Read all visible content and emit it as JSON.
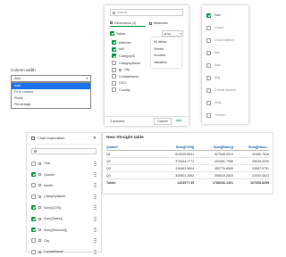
{
  "fields_panel": {
    "search_placeholder": "Search",
    "tab_dimensions": "Dimensions (4)",
    "tab_measures": "Measures",
    "tables_label": "Tables",
    "filter_value": "All tab...",
    "items": [
      {
        "label": "Address",
        "checked": true
      },
      {
        "label": "sell",
        "checked": true
      },
      {
        "label": "CategoryID",
        "checked": true
      },
      {
        "label": "CategoryName",
        "checked": false
      },
      {
        "label": "City",
        "checked": false
      },
      {
        "label": "ContactName",
        "checked": false
      },
      {
        "label": "CEO",
        "checked": false
      },
      {
        "label": "Country",
        "checked": false
      }
    ],
    "filter_menu": [
      "All tables",
      "Sheets",
      "Invoices",
      "Variables"
    ],
    "selected_count": "3 selected",
    "cancel_label": "Cancel",
    "add_label": "Add"
  },
  "aggregation_panel": {
    "items": [
      {
        "label": "Sum",
        "checked": true
      },
      {
        "label": "Count",
        "checked": false
      },
      {
        "label": "Count distinct",
        "checked": false
      },
      {
        "label": "Min",
        "checked": false
      },
      {
        "label": "Max",
        "checked": false
      },
      {
        "label": "Avg",
        "checked": false
      },
      {
        "label": "Concat distinct",
        "checked": false
      },
      {
        "label": "Only",
        "checked": false
      },
      {
        "label": "<None>",
        "checked": false
      }
    ]
  },
  "column_width": {
    "title": "Column width",
    "selected": "Auto",
    "options": [
      "Auto",
      "Fit to content",
      "Pixels",
      "Percentage"
    ]
  },
  "chart_exploration": {
    "title": "Chart exploration",
    "items": [
      {
        "label": "Year",
        "checked": false
      },
      {
        "label": "Quarter",
        "checked": true
      },
      {
        "label": "Month",
        "checked": false
      },
      {
        "label": "CategoryName",
        "checked": false
      },
      {
        "label": "Sum([COS])",
        "checked": true
      },
      {
        "label": "Sum([Sales])",
        "checked": true
      },
      {
        "label": "Sum([Discount])",
        "checked": true
      },
      {
        "label": "City",
        "checked": false
      },
      {
        "label": "ContactName",
        "checked": false
      },
      {
        "label": "Country",
        "checked": false
      }
    ]
  },
  "table": {
    "title": "New Straight table",
    "headers": [
      "Quarter",
      "Sum([COS])",
      "Sum([Sales])",
      "Sum([Disco..."
    ],
    "rows": [
      [
        "Q1",
        "624026.8941",
        "527538.9019",
        "32480.7616"
      ],
      [
        "Q2",
        "373454.1772",
        "403451.7956",
        "39035.3209"
      ],
      [
        "Q3",
        "316462.9804",
        "452776.8555",
        "33087.0751"
      ],
      [
        "Q4",
        "309804.3852",
        "398518.2825",
        "23305.4623"
      ]
    ],
    "totals": [
      "Totals",
      "1423977.35",
      "1788036.1401",
      "167658.8255"
    ]
  }
}
